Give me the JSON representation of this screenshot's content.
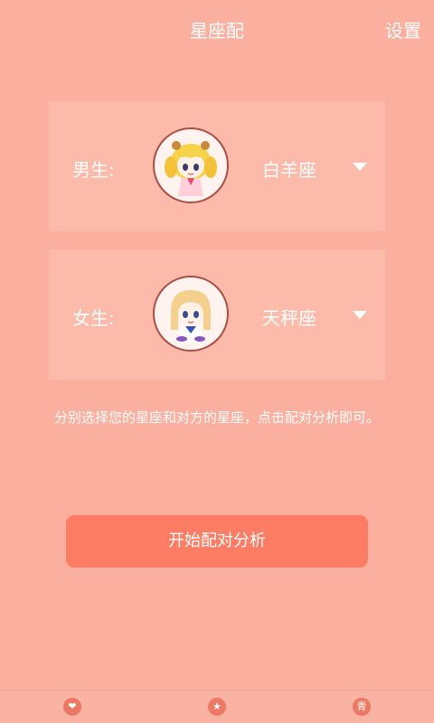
{
  "header": {
    "title": "星座配",
    "settings_label": "设置"
  },
  "male": {
    "label": "男生:",
    "sign": "白羊座",
    "avatar_icon": "aries-avatar-icon"
  },
  "female": {
    "label": "女生:",
    "sign": "天秤座",
    "avatar_icon": "libra-avatar-icon"
  },
  "hint": "分别选择您的星座和对方的星座，点击配对分析即可。",
  "start_button": "开始配对分析",
  "bottom_nav": {
    "items": [
      {
        "icon": "heart-icon",
        "glyph": "❤"
      },
      {
        "icon": "star-icon",
        "glyph": "★"
      },
      {
        "icon": "char-icon",
        "glyph": "青"
      }
    ]
  },
  "colors": {
    "background": "#fbaf9f",
    "card": "#fcbaaa",
    "button": "#fc7d63",
    "text": "#ffffff"
  }
}
